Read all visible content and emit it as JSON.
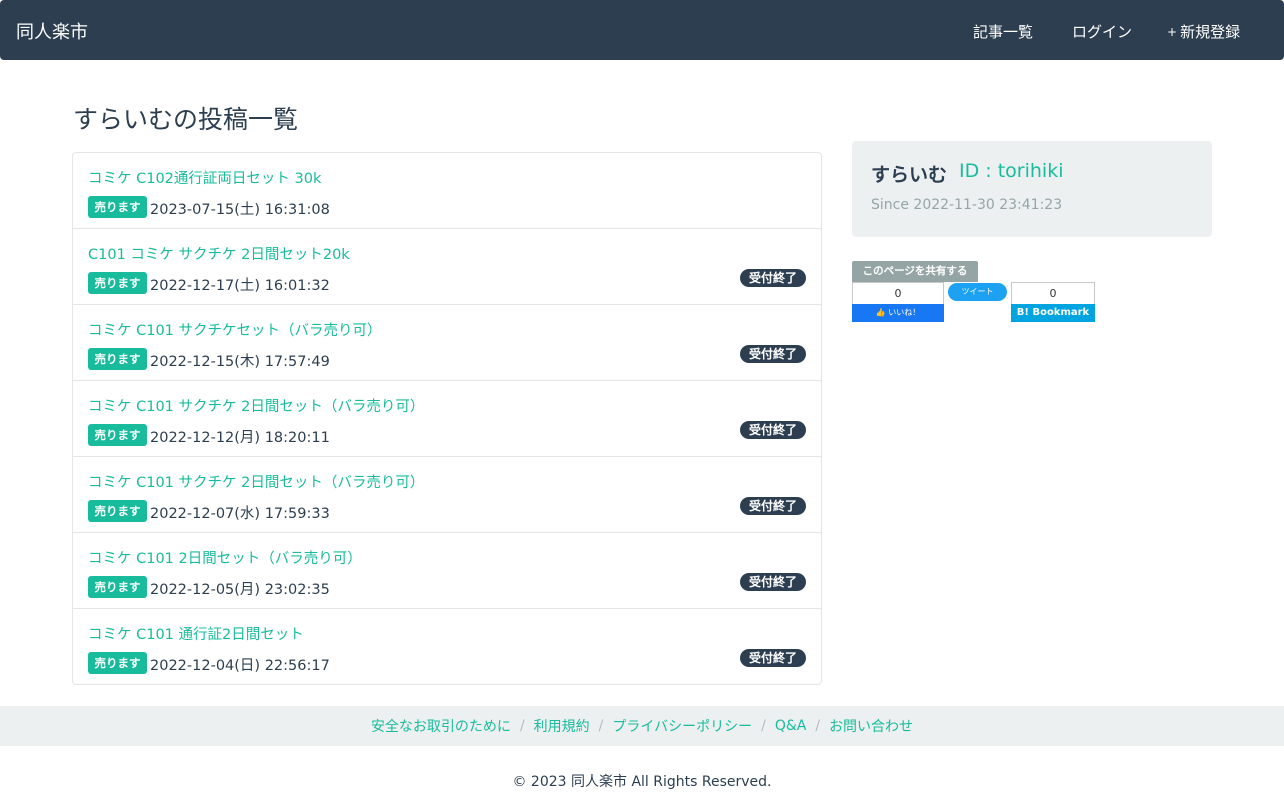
{
  "nav": {
    "brand": "同人楽市",
    "articles": "記事一覧",
    "login": "ログイン",
    "register": "新規登録",
    "articles_icon": "",
    "login_icon": "",
    "register_icon": "+"
  },
  "page_title": "すらいむの投稿一覧",
  "posts": [
    {
      "title": "コミケ C102通行証両日セット 30k",
      "type": "売ります",
      "date": "2023-07-15(土) 16:31:08",
      "status": ""
    },
    {
      "title": "C101 コミケ サクチケ 2日間セット20k",
      "type": "売ります",
      "date": "2022-12-17(土) 16:01:32",
      "status": "受付終了"
    },
    {
      "title": "コミケ C101 サクチケセット（バラ売り可）",
      "type": "売ります",
      "date": "2022-12-15(木) 17:57:49",
      "status": "受付終了"
    },
    {
      "title": "コミケ C101 サクチケ 2日間セット（バラ売り可）",
      "type": "売ります",
      "date": "2022-12-12(月) 18:20:11",
      "status": "受付終了"
    },
    {
      "title": "コミケ C101 サクチケ 2日間セット（バラ売り可）",
      "type": "売ります",
      "date": "2022-12-07(水) 17:59:33",
      "status": "受付終了"
    },
    {
      "title": "コミケ C101 2日間セット（バラ売り可）",
      "type": "売ります",
      "date": "2022-12-05(月) 23:02:35",
      "status": "受付終了"
    },
    {
      "title": "コミケ C101 通行証2日間セット",
      "type": "売ります",
      "date": "2022-12-04(日) 22:56:17",
      "status": "受付終了"
    }
  ],
  "profile": {
    "user_icon": "",
    "name": "すらいむ",
    "id_text": "ID : torihiki",
    "clock_icon": "",
    "since": "Since 2022-11-30 23:41:23"
  },
  "share": {
    "label": "このページを共有する",
    "fb_count": "0",
    "fb_label": "👍 いいね！",
    "tw_label": "ツイート",
    "hb_count": "0",
    "hb_label": "B! Bookmark"
  },
  "footer": {
    "links": [
      "安全なお取引のために",
      "利用規約",
      "プライバシーポリシー",
      "Q&A",
      "お問い合わせ"
    ],
    "separator": "/",
    "copyright": "© 2023 同人楽市 All Rights Reserved."
  },
  "colors": {
    "navbar": "#2c3e50",
    "accent": "#18bc9c",
    "panel": "#ecf0f1"
  }
}
